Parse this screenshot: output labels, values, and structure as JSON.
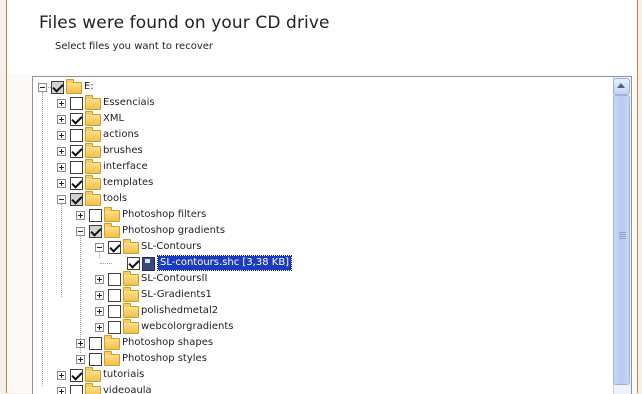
{
  "header": {
    "title": "Files were found on your CD drive",
    "subtitle": "Select files you want to recover"
  },
  "tree": {
    "root": {
      "label": "E:",
      "check": "gray",
      "expanded": true
    },
    "items": [
      {
        "label": "Essenciais",
        "check": "none",
        "expanded": false
      },
      {
        "label": "XML",
        "check": "checked",
        "expanded": false
      },
      {
        "label": "actions",
        "check": "none",
        "expanded": false
      },
      {
        "label": "brushes",
        "check": "checked",
        "expanded": false
      },
      {
        "label": "interface",
        "check": "none",
        "expanded": false
      },
      {
        "label": "templates",
        "check": "checked",
        "expanded": false
      },
      {
        "label": "tools",
        "check": "gray",
        "expanded": true
      },
      {
        "label": "Photoshop filters",
        "check": "none",
        "expanded": false
      },
      {
        "label": "Photoshop gradients",
        "check": "gray",
        "expanded": true
      },
      {
        "label": "SL-Contours",
        "check": "checked",
        "expanded": true
      },
      {
        "label": "SL-contours.shc",
        "size": "[3,38 KB]",
        "check": "checked",
        "selected": true
      },
      {
        "label": "SL-ContoursII",
        "check": "none",
        "expanded": false
      },
      {
        "label": "SL-Gradients1",
        "check": "none",
        "expanded": false
      },
      {
        "label": "polishedmetal2",
        "check": "none",
        "expanded": false
      },
      {
        "label": "webcolorgradients",
        "check": "none",
        "expanded": false
      },
      {
        "label": "Photoshop shapes",
        "check": "none",
        "expanded": false
      },
      {
        "label": "Photoshop styles",
        "check": "none",
        "expanded": false
      },
      {
        "label": "tutoriais",
        "check": "checked",
        "expanded": false
      },
      {
        "label": "videoaula",
        "check": "none",
        "expanded": false
      }
    ]
  },
  "icons": {
    "folder": "folder-icon",
    "file": "disk-file-icon",
    "scroll_up": "scroll-up-arrow-icon"
  },
  "colors": {
    "accent_border": "#d67a36",
    "selection": "#1b3cbe",
    "folder": "#f1c04a"
  }
}
